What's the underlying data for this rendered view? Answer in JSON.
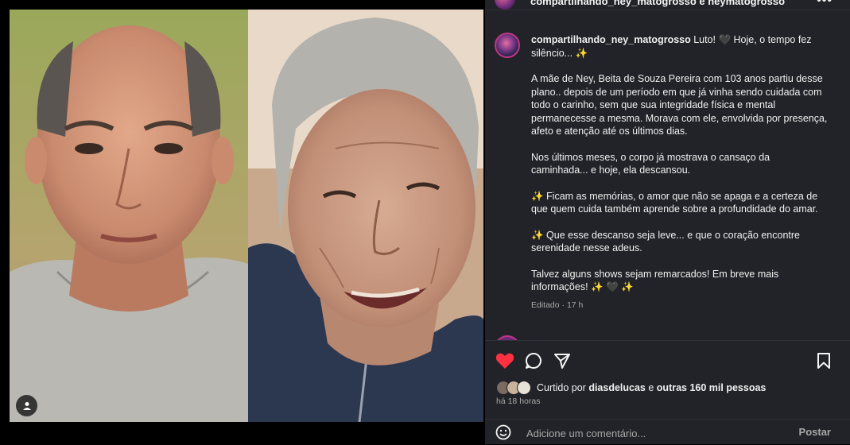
{
  "header": {
    "text": "compartilhando_ney_matogrosso e neymatogrosso",
    "more_label": "•••"
  },
  "caption": {
    "username": "compartilhando_ney_matogrosso",
    "line1": " Luto! 🖤 Hoje, o tempo fez silêncio... ✨",
    "para2": "A mãe de Ney, Beita de Souza Pereira com 103 anos partiu desse plano.. depois de um período em que já vinha sendo cuidada com todo o carinho, sem que sua integridade física e mental permanecesse a mesma. Morava com ele, envolvida por presença, afeto e atenção até os últimos dias.",
    "para3": "Nos últimos meses, o corpo já mostrava o cansaço da caminhada... e hoje, ela descansou.",
    "para4": "✨ Ficam as memórias, o amor que não se apaga e a certeza de que quem cuida também aprende sobre a profundidade do amar.",
    "para5": "✨ Que esse descanso seja leve... e que o coração encontre serenidade nesse adeus.",
    "para6": "Talvez alguns shows sejam remarcados! Em breve mais informações! ✨ 🖤 ✨",
    "meta": "Editado · 17 h"
  },
  "actions": {
    "liked_by_prefix": "Curtido por ",
    "liked_by_user": "diasdelucas",
    "liked_by_connector": " e ",
    "liked_by_others": "outras 160 mil pessoas",
    "time_ago": "há 18 horas"
  },
  "comment": {
    "placeholder": "Adicione um comentário...",
    "post_label": "Postar"
  },
  "colors": {
    "panel_bg": "#212328",
    "like_red": "#ff3040",
    "text": "#f5f5f5",
    "secondary": "#a8a8a8"
  }
}
